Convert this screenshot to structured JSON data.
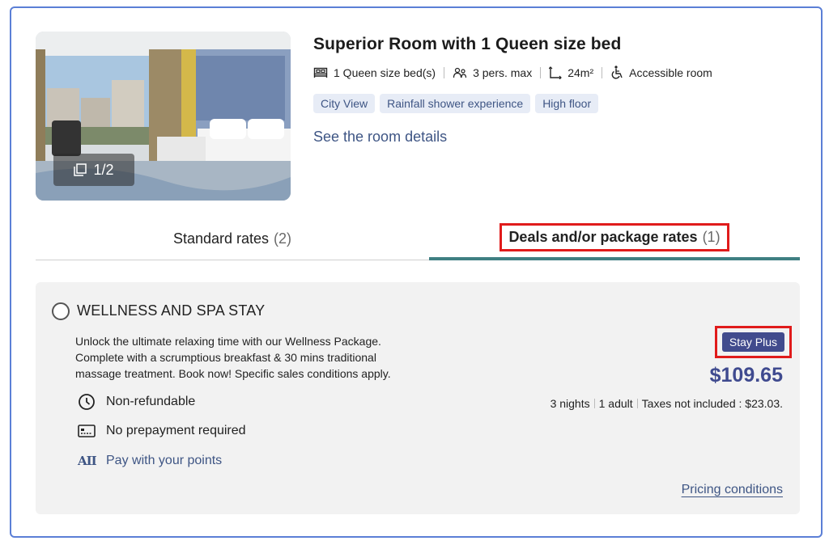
{
  "room": {
    "title": "Superior Room with 1 Queen size bed",
    "photo_counter": "1/2",
    "features": [
      {
        "icon": "bed-icon",
        "label": "1 Queen size bed(s)"
      },
      {
        "icon": "persons-icon",
        "label": "3 pers. max"
      },
      {
        "icon": "area-icon",
        "label": "24m²"
      },
      {
        "icon": "wheelchair-icon",
        "label": "Accessible room"
      }
    ],
    "tags": [
      "City View",
      "Rainfall shower experience",
      "High floor"
    ],
    "details_link": "See the room details"
  },
  "tabs": {
    "standard": {
      "label": "Standard rates",
      "count": "(2)"
    },
    "deals": {
      "label": "Deals and/or package rates",
      "count": "(1)",
      "active": true
    }
  },
  "offer": {
    "title": "WELLNESS AND SPA STAY",
    "description": "Unlock the ultimate relaxing time with our Wellness Package. Complete with a scrumptious breakfast & 30 mins traditional massage treatment. Book now! Specific sales conditions apply.",
    "conditions": [
      {
        "icon": "clock-icon",
        "label": "Non-refundable"
      },
      {
        "icon": "card-icon",
        "label": "No prepayment required"
      },
      {
        "icon": "all-logo-icon",
        "label": "Pay with your points",
        "logo_text": "AII"
      }
    ],
    "badge": "Stay Plus",
    "price": "$109.65",
    "nights": "3 nights",
    "guests": "1 adult",
    "taxes": "Taxes not included : $23.03.",
    "pricing_link": "Pricing conditions"
  },
  "colors": {
    "accent": "#3e5584",
    "price": "#3f4a8f",
    "badge_bg": "#414b8d",
    "tab_underline": "#3f7f82",
    "highlight": "#e01b1b",
    "card_border": "#5b7fd6"
  }
}
